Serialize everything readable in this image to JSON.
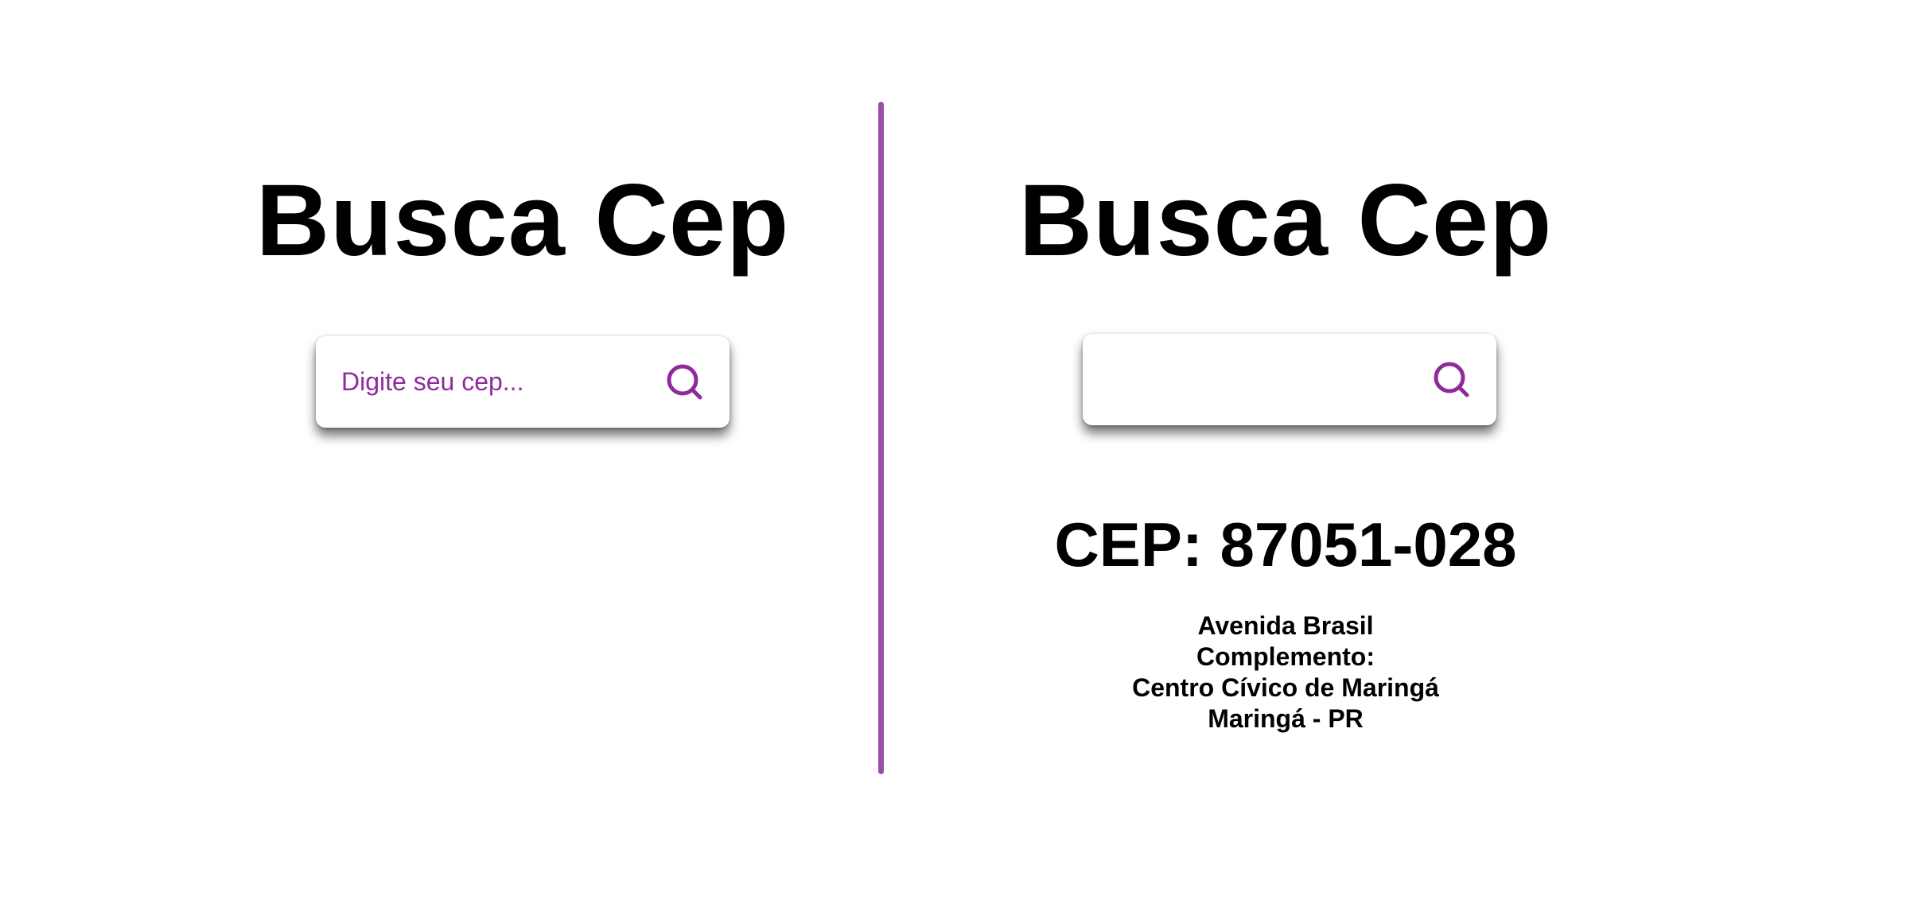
{
  "colors": {
    "accent": "#9b4ea8",
    "icon": "#8e2b9b",
    "text": "#000000",
    "background": "#ffffff"
  },
  "left_panel": {
    "title": "Busca Cep",
    "search": {
      "placeholder": "Digite seu cep...",
      "value": "",
      "icon": "search-icon"
    }
  },
  "right_panel": {
    "title": "Busca Cep",
    "search": {
      "placeholder": "",
      "value": "",
      "icon": "search-icon"
    },
    "result": {
      "cep_heading": "CEP: 87051-028",
      "street": "Avenida Brasil",
      "complement": "Complemento:",
      "neighborhood": "Centro Cívico de Maringá",
      "city_state": "Maringá - PR"
    }
  }
}
